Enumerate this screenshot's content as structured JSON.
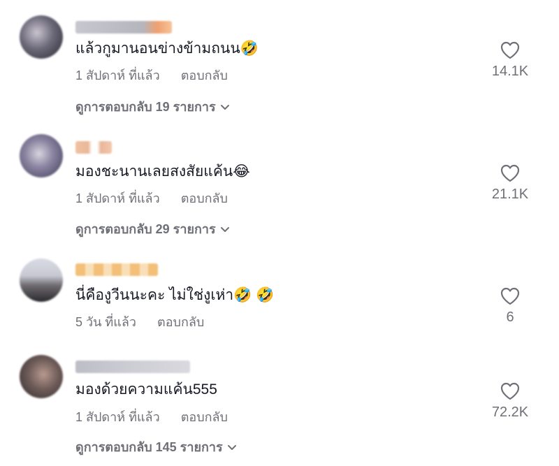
{
  "comments": [
    {
      "text": "แล้วกูมานอนข่างข้ามถนน🤣",
      "time": "1 สัปดาห์ ที่แล้ว",
      "reply_label": "ตอบกลับ",
      "like_count": "14.1K",
      "view_replies": "ดูการตอบกลับ 19 รายการ"
    },
    {
      "text": "มองชะนานเลยสงสัยแค้น😂",
      "time": "1 สัปดาห์ ที่แล้ว",
      "reply_label": "ตอบกลับ",
      "like_count": "21.1K",
      "view_replies": "ดูการตอบกลับ 29 รายการ"
    },
    {
      "text": "นี่คืองูวีนนะคะ ไม่ใช่งูเห่า🤣 🤣",
      "time": "5 วัน ที่แล้ว",
      "reply_label": "ตอบกลับ",
      "like_count": "6"
    },
    {
      "text": "มองด้วยความแค้น555",
      "time": "1 สัปดาห์ ที่แล้ว",
      "reply_label": "ตอบกลับ",
      "like_count": "72.2K",
      "view_replies": "ดูการตอบกลับ 145 รายการ"
    }
  ],
  "icons": {
    "like": "heart-outline-icon",
    "expand": "chevron-down-icon"
  },
  "colors": {
    "text": "#161823",
    "muted": "#6f7077"
  }
}
